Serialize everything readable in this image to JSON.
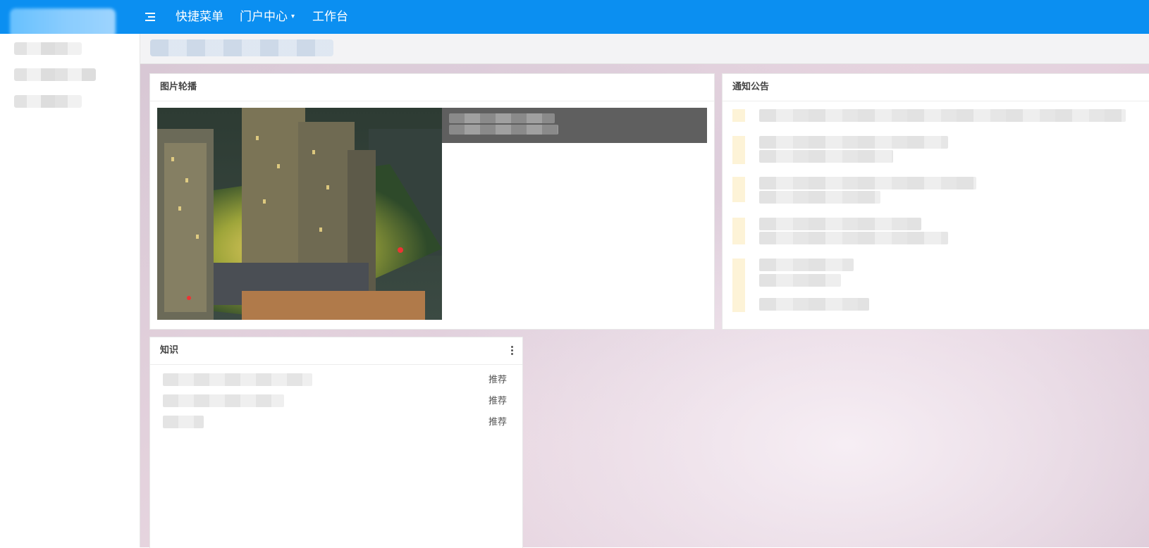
{
  "topbar": {
    "nav": [
      {
        "label": "快捷菜单"
      },
      {
        "label": "门户中心",
        "caret": "▾"
      },
      {
        "label": "工作台"
      }
    ]
  },
  "cards": {
    "carousel": {
      "title": "图片轮播"
    },
    "notices": {
      "title": "通知公告"
    },
    "knowledge": {
      "title": "知识",
      "rows": [
        {
          "tag": "推荐"
        },
        {
          "tag": "推荐"
        },
        {
          "tag": "推荐"
        }
      ]
    }
  },
  "colors": {
    "topbar": "#0b8ff1",
    "caption_bar": "#5f5f5f",
    "notice_marker": "#fdf3d7"
  },
  "icons": {
    "menu_toggle": "menu-list-icon",
    "more": "more-vertical-icon"
  }
}
